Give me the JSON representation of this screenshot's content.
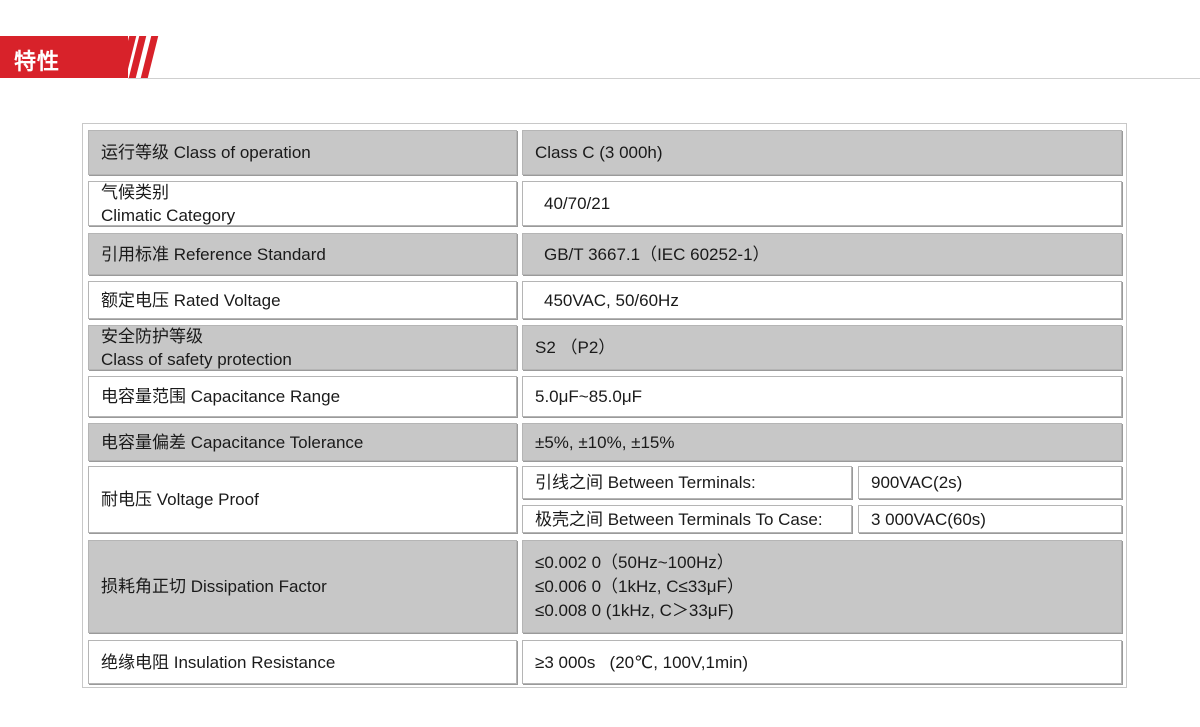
{
  "header": {
    "title": "特性"
  },
  "rows": [
    {
      "label": "运行等级 Class of operation",
      "value": "Class C (3 000h)"
    },
    {
      "label_cn": "气候类别",
      "label_en": "Climatic Category",
      "value": "40/70/21"
    },
    {
      "label": "引用标准 Reference Standard",
      "value": "GB/T 3667.1（IEC 60252-1）"
    },
    {
      "label": "额定电压 Rated Voltage",
      "value": "450VAC, 50/60Hz"
    },
    {
      "label_cn": "安全防护等级",
      "label_en": "Class of safety protection",
      "value": "S2 （P2）"
    },
    {
      "label": "电容量范围 Capacitance Range",
      "value": "5.0μF~85.0μF"
    },
    {
      "label": "电容量偏差 Capacitance Tolerance",
      "value": "±5%, ±10%, ±15%"
    },
    {
      "label": "耐电压 Voltage Proof",
      "sub": [
        {
          "name": "引线之间   Between Terminals:",
          "value": "900VAC(2s)"
        },
        {
          "name": "极壳之间 Between Terminals To Case:",
          "value": "3 000VAC(60s)"
        }
      ]
    },
    {
      "label": "损耗角正切 Dissipation Factor",
      "lines": [
        "≤0.002 0（50Hz~100Hz）",
        "≤0.006 0（1kHz, C≤33μF）",
        "≤0.008 0 (1kHz, C＞33μF)"
      ]
    },
    {
      "label": "绝缘电阻 Insulation Resistance",
      "value": "≥3 000s   (20℃, 100V,1min)"
    }
  ]
}
